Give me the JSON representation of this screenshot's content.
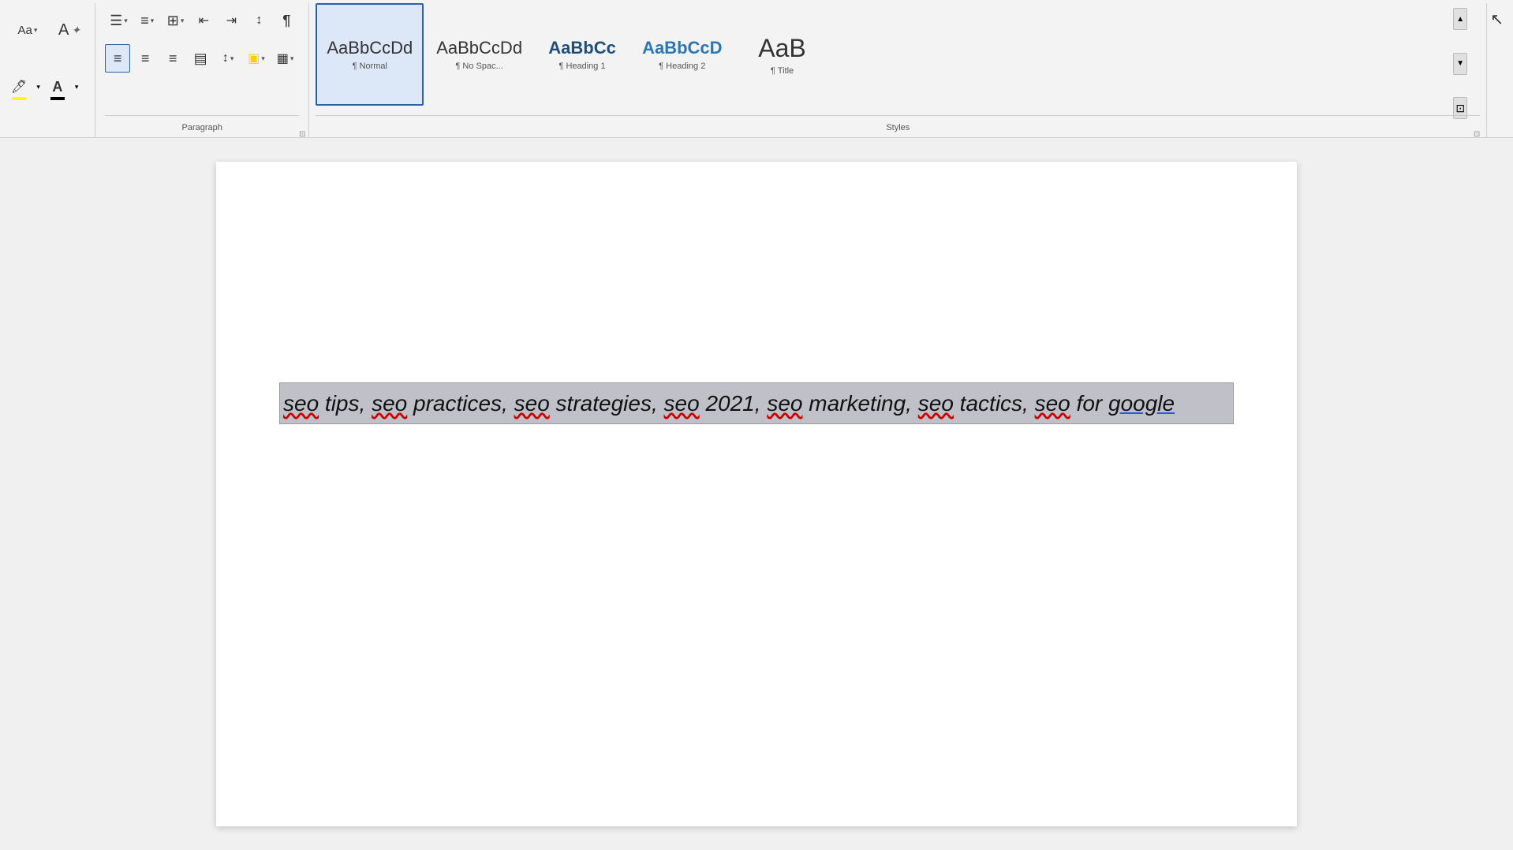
{
  "toolbar": {
    "font_name": "Aa",
    "font_size_icon": "A",
    "bullets_label": "Bullets",
    "numbering_label": "Numbering",
    "multilevel_label": "Multilevel",
    "decrease_indent_label": "Decrease Indent",
    "increase_indent_label": "Increase Indent",
    "sort_label": "Sort",
    "show_para_label": "Show Paragraph",
    "align_left_label": "Align Left",
    "align_center_label": "Align Center",
    "align_right_label": "Align Right",
    "justify_label": "Justify",
    "line_spacing_label": "Line Spacing",
    "highlight_label": "Highlight",
    "font_color_label": "Font Color",
    "borders_label": "Borders",
    "shading_label": "Shading",
    "paragraph_section": "Paragraph",
    "styles_section": "Styles"
  },
  "styles": {
    "items": [
      {
        "id": "normal",
        "preview": "AaBbCcDd",
        "label": "Normal",
        "label_icon": "¶",
        "active": true
      },
      {
        "id": "no-spacing",
        "preview": "AaBbCcDd",
        "label": "No Spac...",
        "label_icon": "¶"
      },
      {
        "id": "heading1",
        "preview": "AaBbCc",
        "label": "Heading 1",
        "label_icon": "¶"
      },
      {
        "id": "heading2",
        "preview": "AaBbCcD",
        "label": "Heading 2",
        "label_icon": "¶"
      },
      {
        "id": "title",
        "preview": "AaB",
        "label": "Title",
        "label_icon": "¶"
      }
    ]
  },
  "document": {
    "selected_text": "seo tips, seo practices, seo strategies, seo 2021, seo marketing, seo tactics, seo for google"
  }
}
